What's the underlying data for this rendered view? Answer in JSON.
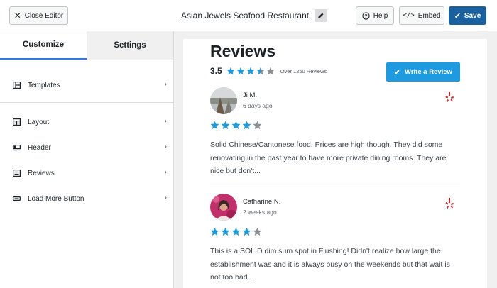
{
  "topbar": {
    "close_label": "Close Editor",
    "title": "Asian Jewels Seafood Restaurant",
    "help_label": "Help",
    "embed_label": "Embed",
    "save_label": "Save"
  },
  "sidebar": {
    "tabs": [
      {
        "label": "Customize",
        "active": true
      },
      {
        "label": "Settings",
        "active": false
      }
    ],
    "items": [
      {
        "label": "Templates",
        "icon": "templates-icon"
      },
      {
        "label": "Layout",
        "icon": "layout-icon"
      },
      {
        "label": "Header",
        "icon": "header-icon"
      },
      {
        "label": "Reviews",
        "icon": "reviews-icon"
      },
      {
        "label": "Load More Button",
        "icon": "load-more-icon"
      }
    ]
  },
  "preview": {
    "title": "Reviews",
    "rating": "3.5",
    "rating_value": 3.5,
    "rating_count": "Over 1250 Reviews",
    "write_label": "Write a Review",
    "reviews": [
      {
        "name": "Ji M.",
        "date": "6 days ago",
        "stars": 4,
        "text": "Solid Chinese/Cantonese food. Prices are high though. They did some renovating in the past year to have more private dining rooms. They are nice but don't..."
      },
      {
        "name": "Catharine N.",
        "date": "2 weeks ago",
        "stars": 4,
        "text": "This is a SOLID dim sum spot in Flushing! Didn't realize how large the establishment was and it is always busy on the weekends but that wait is not too bad...."
      }
    ]
  },
  "colors": {
    "star_blue": "#1e9be0",
    "star_gray": "#8c8f94",
    "save_blue": "#1a5f9e",
    "yelp_red": "#d32323"
  }
}
